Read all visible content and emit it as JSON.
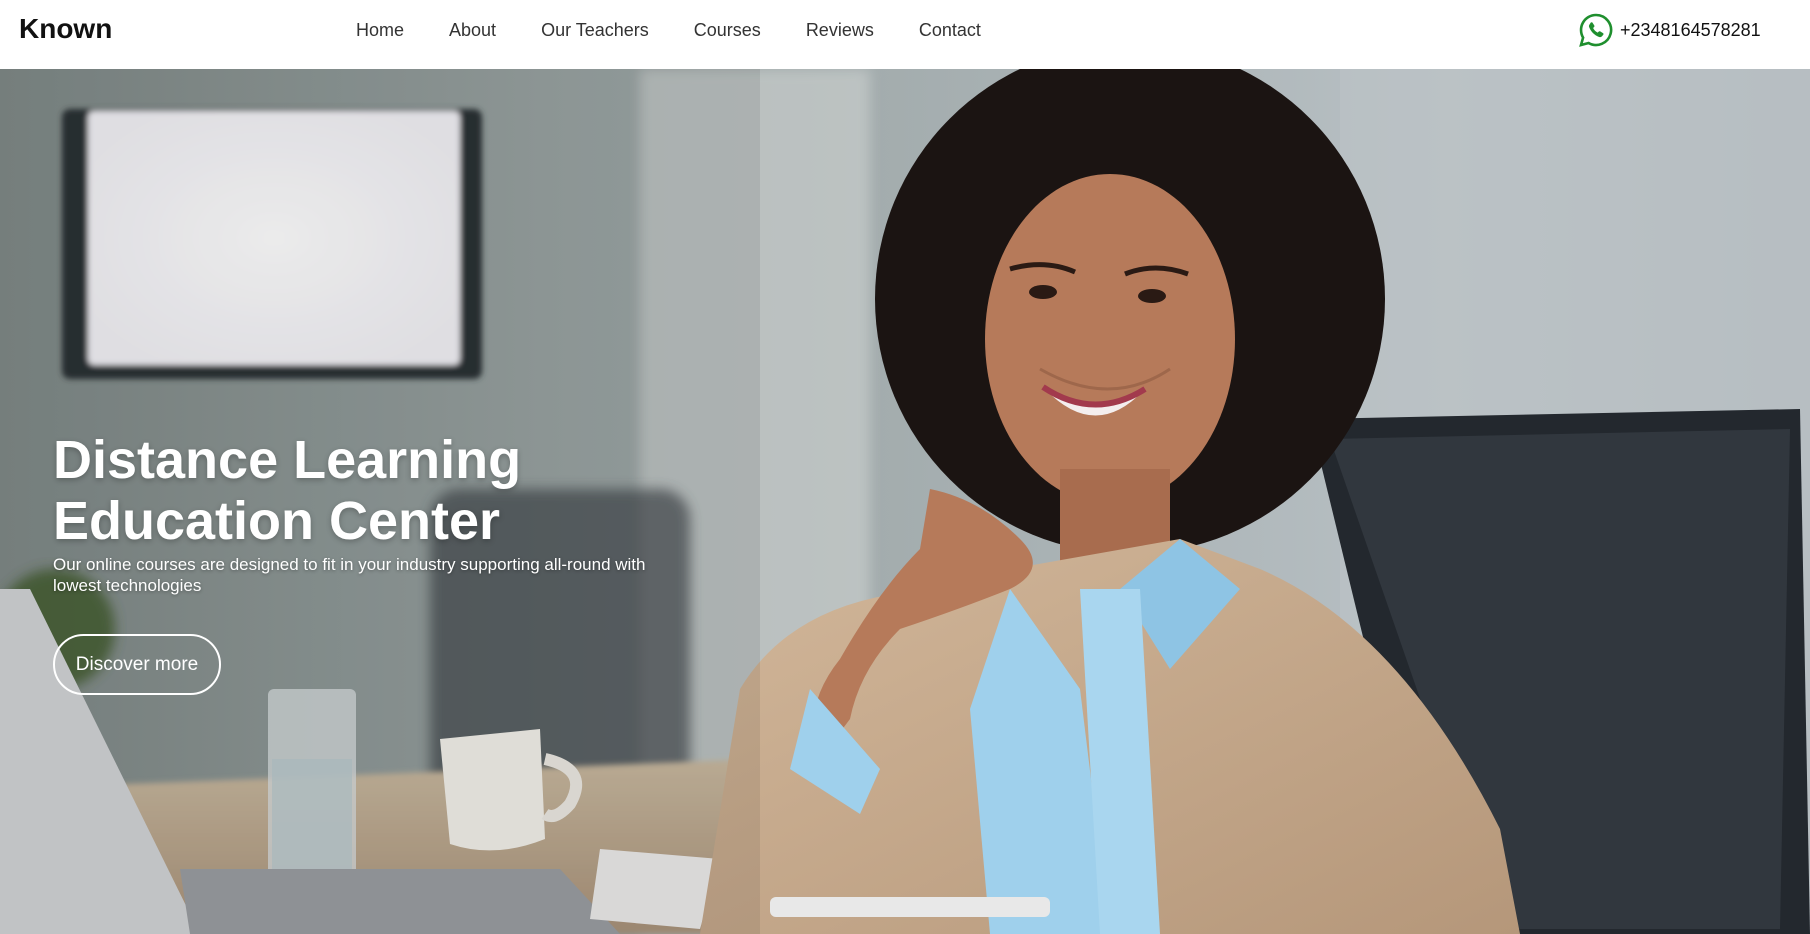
{
  "header": {
    "brand": "Known",
    "nav": [
      "Home",
      "About",
      "Our Teachers",
      "Courses",
      "Reviews",
      "Contact"
    ],
    "phone": "+2348164578281",
    "phone_icon": "whatsapp-icon",
    "phone_icon_color": "#1f8f2e"
  },
  "hero": {
    "title_line1": "Distance Learning",
    "title_line2": "Education Center",
    "subtitle": "Our online courses are designed to fit in your industry supporting all-round with lowest technologies",
    "cta": "Discover more"
  }
}
